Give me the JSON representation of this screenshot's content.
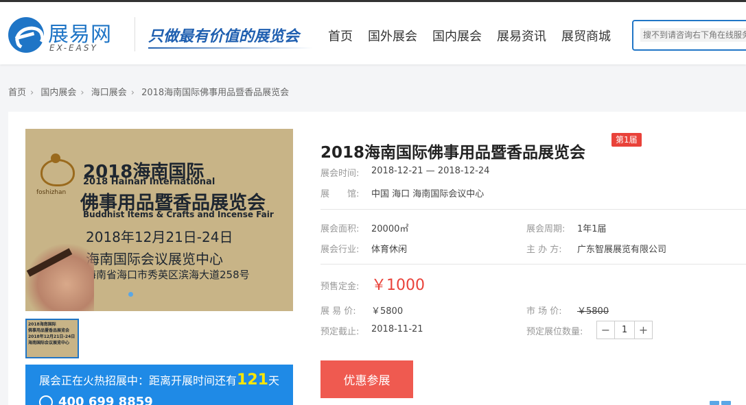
{
  "header": {
    "logo_cn": "展易网",
    "logo_en": "EX-EASY",
    "slogan": "只做最有价值的展览会",
    "nav": [
      "首页",
      "国外展会",
      "国内展会",
      "展易资讯",
      "展贸商城"
    ],
    "search_placeholder": "搜不到请咨询右下角在线服务"
  },
  "breadcrumb": [
    "首页",
    "国内展会",
    "海口展会",
    "2018海南国际佛事用品暨香品展览会"
  ],
  "poster": {
    "line1": "2018海南国际",
    "line2": "2018 Hainan International",
    "line3": "佛事用品暨香品展览会",
    "line4": "Buddhist Items & Crafts and Incense Fair",
    "line5": "2018年12月21日-24日",
    "line6": "海南国际会议展览中心",
    "line7": "海南省海口市秀英区滨海大道258号",
    "mark": "foshizhan"
  },
  "thumb": {
    "line1": "2018海南国际",
    "line2": "佛事用品暨香品展览会",
    "line3": "2018年12月21日-24日",
    "line4": "海南国际会议展览中心"
  },
  "promo": {
    "text_before": "展会正在火热招展中：距离开展时间还有",
    "days": "121",
    "text_after": "天",
    "phone": "400 699 8859"
  },
  "detail": {
    "title": "2018海南国际佛事用品暨香品展览会",
    "badge": "第1届",
    "time_label": "展会时间:",
    "time_value": "2018-12-21 — 2018-12-24",
    "venue_label": "展　　馆:",
    "venue_value": "中国  海口  海南国际会议中心",
    "area_label": "展会面积:",
    "area_value": "20000㎡",
    "cycle_label": "展会周期:",
    "cycle_value": "1年1届",
    "industry_label": "展会行业:",
    "industry_value": "体育休闲",
    "organizer_label": "主 办 方:",
    "organizer_value": "广东智展展览有限公司",
    "deposit_label": "预售定金:",
    "deposit_value": "￥1000",
    "easy_price_label": "展 易 价:",
    "easy_price_value": "￥5800",
    "market_price_label": "市 场 价:",
    "market_price_value": "￥5800",
    "deadline_label": "预定截止:",
    "deadline_value": "2018-11-21",
    "booth_qty_label": "预定展位数量:",
    "booth_qty_value": "1",
    "minus": "−",
    "plus": "+",
    "cta": "优惠参展"
  },
  "colors": {
    "brand_blue": "#1f75c6",
    "accent_red": "#e9423a",
    "cta_red": "#ef5a50",
    "promo_blue": "#1f8ae6",
    "promo_highlight": "#ffe600"
  }
}
